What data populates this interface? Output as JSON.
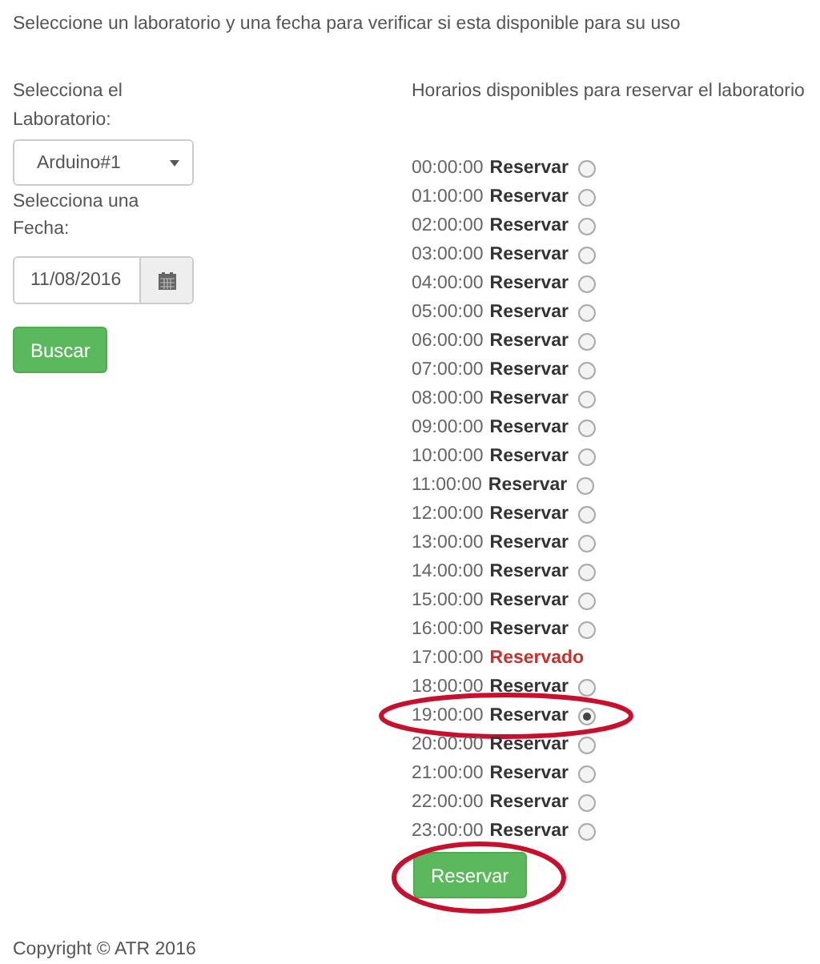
{
  "intro": "Seleccione un laboratorio y una fecha para verificar si esta disponible para su uso",
  "lab_label": "Selecciona el Laboratorio:",
  "lab_select": {
    "value": "Arduino#1"
  },
  "date_label": "Selecciona una Fecha:",
  "date_field": {
    "value": "11/08/2016"
  },
  "search_button": "Buscar",
  "schedule_heading": "Horarios disponibles para reservar el laboratorio",
  "slots": [
    {
      "time": "00:00:00",
      "status": "Reservar",
      "kind": "free",
      "selected": false,
      "circled": false
    },
    {
      "time": "01:00:00",
      "status": "Reservar",
      "kind": "free",
      "selected": false,
      "circled": false
    },
    {
      "time": "02:00:00",
      "status": "Reservar",
      "kind": "free",
      "selected": false,
      "circled": false
    },
    {
      "time": "03:00:00",
      "status": "Reservar",
      "kind": "free",
      "selected": false,
      "circled": false
    },
    {
      "time": "04:00:00",
      "status": "Reservar",
      "kind": "free",
      "selected": false,
      "circled": false
    },
    {
      "time": "05:00:00",
      "status": "Reservar",
      "kind": "free",
      "selected": false,
      "circled": false
    },
    {
      "time": "06:00:00",
      "status": "Reservar",
      "kind": "free",
      "selected": false,
      "circled": false
    },
    {
      "time": "07:00:00",
      "status": "Reservar",
      "kind": "free",
      "selected": false,
      "circled": false
    },
    {
      "time": "08:00:00",
      "status": "Reservar",
      "kind": "free",
      "selected": false,
      "circled": false
    },
    {
      "time": "09:00:00",
      "status": "Reservar",
      "kind": "free",
      "selected": false,
      "circled": false
    },
    {
      "time": "10:00:00",
      "status": "Reservar",
      "kind": "free",
      "selected": false,
      "circled": false
    },
    {
      "time": "11:00:00",
      "status": "Reservar",
      "kind": "free",
      "selected": false,
      "circled": false
    },
    {
      "time": "12:00:00",
      "status": "Reservar",
      "kind": "free",
      "selected": false,
      "circled": false
    },
    {
      "time": "13:00:00",
      "status": "Reservar",
      "kind": "free",
      "selected": false,
      "circled": false
    },
    {
      "time": "14:00:00",
      "status": "Reservar",
      "kind": "free",
      "selected": false,
      "circled": false
    },
    {
      "time": "15:00:00",
      "status": "Reservar",
      "kind": "free",
      "selected": false,
      "circled": false
    },
    {
      "time": "16:00:00",
      "status": "Reservar",
      "kind": "free",
      "selected": false,
      "circled": false
    },
    {
      "time": "17:00:00",
      "status": "Reservado",
      "kind": "reserved",
      "circled": false
    },
    {
      "time": "18:00:00",
      "status": "Reservar",
      "kind": "free",
      "selected": false,
      "circled": false
    },
    {
      "time": "19:00:00",
      "status": "Reservar",
      "kind": "free",
      "selected": true,
      "circled": true
    },
    {
      "time": "20:00:00",
      "status": "Reservar",
      "kind": "free",
      "selected": false,
      "circled": false
    },
    {
      "time": "21:00:00",
      "status": "Reservar",
      "kind": "free",
      "selected": false,
      "circled": false
    },
    {
      "time": "22:00:00",
      "status": "Reservar",
      "kind": "free",
      "selected": false,
      "circled": false
    },
    {
      "time": "23:00:00",
      "status": "Reservar",
      "kind": "free",
      "selected": false,
      "circled": false
    }
  ],
  "reserve_button": {
    "label": "Reservar",
    "circled": true
  },
  "footer": "Copyright © ATR 2016"
}
